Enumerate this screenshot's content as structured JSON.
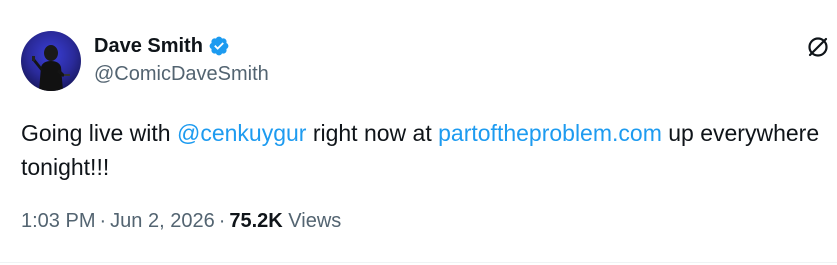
{
  "author": {
    "display_name": "Dave Smith",
    "handle": "@ComicDaveSmith",
    "verified_icon": "verified-badge-icon",
    "avatar": "avatar-photo"
  },
  "tweet": {
    "text_1": "Going live with ",
    "mention": "@cenkuygur",
    "text_2": " right now at ",
    "link": "partoftheproblem.com",
    "text_3": " up everywhere tonight!!!"
  },
  "meta": {
    "time": "1:03 PM",
    "separator": "·",
    "date": "Jun 2, 2026",
    "views_count": "75.2K",
    "views_label": "Views"
  },
  "brand": {
    "logo_icon": "x-logo-icon"
  },
  "colors": {
    "link": "#1d9bf0",
    "secondary_text": "#536471",
    "primary_text": "#0f1419",
    "verified": "#1d9bf0"
  }
}
